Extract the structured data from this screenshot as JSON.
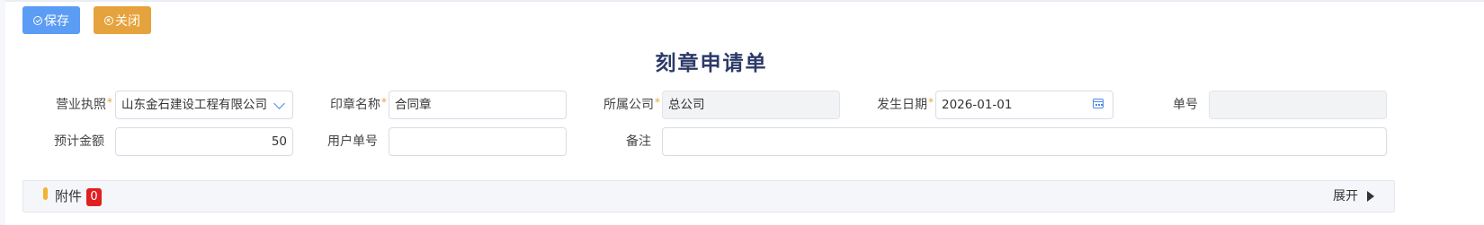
{
  "toolbar": {
    "save_label": "保存",
    "close_label": "关闭"
  },
  "form": {
    "title": "刻章申请单",
    "business_license": {
      "label": "营业执照",
      "value": "山东金石建设工程有限公司"
    },
    "seal_name": {
      "label": "印章名称",
      "value": "合同章"
    },
    "company": {
      "label": "所属公司",
      "value": "总公司"
    },
    "date": {
      "label": "发生日期",
      "value": "2026-01-01"
    },
    "doc_no": {
      "label": "单号",
      "value": ""
    },
    "estimated_amount": {
      "label": "预计金额",
      "value": "50"
    },
    "user_doc_no": {
      "label": "用户单号",
      "value": ""
    },
    "remark": {
      "label": "备注",
      "value": ""
    },
    "required_mark": "*"
  },
  "attachments": {
    "label": "附件",
    "count": "0",
    "expand_label": "展开"
  },
  "colors": {
    "primary": "#5b9cf5",
    "warning": "#e6a23c",
    "title": "#2c3a67",
    "badge": "#e02020"
  }
}
